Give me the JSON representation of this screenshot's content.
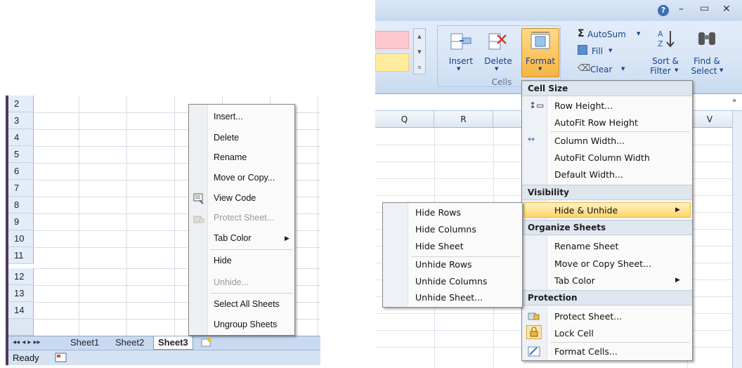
{
  "left": {
    "rows": [
      "2",
      "3",
      "4",
      "5",
      "6",
      "7",
      "8",
      "9",
      "10",
      "11",
      "12",
      "13",
      "14"
    ],
    "nav_arrows": "◂◂ ◂ ▸ ▸▸",
    "sheet_tabs": [
      "Sheet1",
      "Sheet2",
      "Sheet3"
    ],
    "active_sheet": "Sheet3",
    "status": "Ready",
    "context_menu": {
      "items": [
        {
          "label": "Insert...",
          "enabled": true
        },
        {
          "label": "Delete",
          "enabled": true
        },
        {
          "label": "Rename",
          "enabled": true
        },
        {
          "label": "Move or Copy...",
          "enabled": true
        },
        {
          "label": "View Code",
          "enabled": true,
          "icon": "view-code-icon"
        },
        {
          "label": "Protect Sheet...",
          "enabled": false,
          "icon": "protect-sheet-icon"
        },
        {
          "label": "Tab Color",
          "enabled": true,
          "submenu": true
        },
        {
          "label": "Hide",
          "enabled": true
        },
        {
          "label": "Unhide...",
          "enabled": false
        },
        {
          "label": "Select All Sheets",
          "enabled": true
        },
        {
          "label": "Ungroup Sheets",
          "enabled": true
        }
      ]
    }
  },
  "right": {
    "window_controls": {
      "help": "?",
      "minimize": "–",
      "restore": "▭",
      "close": "✕"
    },
    "ribbon": {
      "cells_group_label": "Cells",
      "insert_label": "Insert",
      "delete_label": "Delete",
      "format_label": "Format",
      "autosum_label": "AutoSum",
      "fill_label": "Fill",
      "clear_label": "Clear",
      "sort_label_1": "Sort &",
      "sort_label_2": "Filter",
      "find_label_1": "Find &",
      "find_label_2": "Select",
      "sigma": "Σ"
    },
    "columns": [
      "Q",
      "R",
      "V"
    ],
    "format_menu": {
      "sections": {
        "cell_size": "Cell Size",
        "visibility": "Visibility",
        "organize": "Organize Sheets",
        "protection": "Protection"
      },
      "items": {
        "row_height": "Row Height...",
        "autofit_row": "AutoFit Row Height",
        "column_width": "Column Width...",
        "autofit_column": "AutoFit Column Width",
        "default_width": "Default Width...",
        "hide_unhide": "Hide & Unhide",
        "rename_sheet": "Rename Sheet",
        "move_copy_sheet": "Move or Copy Sheet...",
        "tab_color": "Tab Color",
        "protect_sheet": "Protect Sheet...",
        "lock_cell": "Lock Cell",
        "format_cells": "Format Cells..."
      }
    },
    "hide_submenu": {
      "items": [
        "Hide Rows",
        "Hide Columns",
        "Hide Sheet",
        "Unhide Rows",
        "Unhide Columns",
        "Unhide Sheet..."
      ]
    },
    "accent": {
      "highlight": "#ffd56b",
      "ribbon_text": "#15428b"
    }
  }
}
